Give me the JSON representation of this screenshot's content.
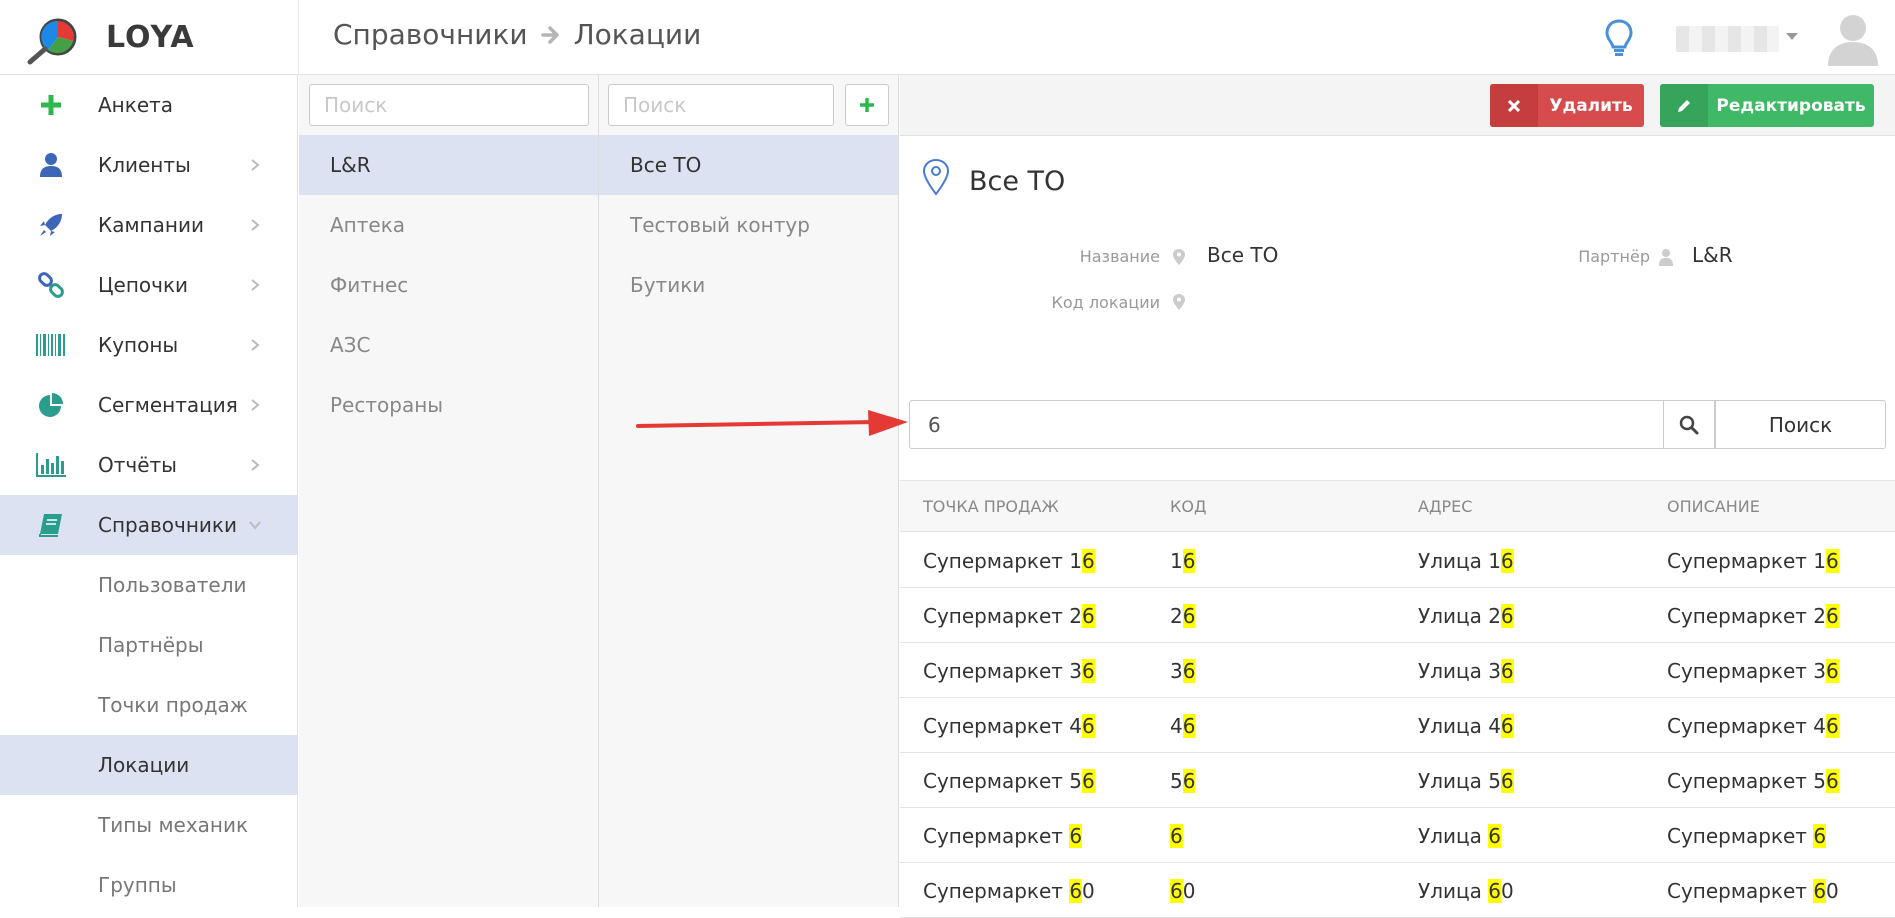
{
  "app": {
    "name": "LOYA"
  },
  "header": {
    "breadcrumb": [
      "Справочники",
      "Локации"
    ]
  },
  "colors": {
    "accent": "#dde2f3",
    "delete": "#d64b4b",
    "edit": "#3fb968",
    "highlight": "#ffff00"
  },
  "sidebar": {
    "items": [
      {
        "label": "Анкета",
        "icon": "plus-icon"
      },
      {
        "label": "Клиенты",
        "icon": "user-icon"
      },
      {
        "label": "Кампании",
        "icon": "rocket-icon"
      },
      {
        "label": "Цепочки",
        "icon": "link-icon"
      },
      {
        "label": "Купоны",
        "icon": "barcode-icon"
      },
      {
        "label": "Сегментация",
        "icon": "pie-chart-icon"
      },
      {
        "label": "Отчёты",
        "icon": "bar-chart-icon"
      },
      {
        "label": "Справочники",
        "icon": "book-icon"
      }
    ],
    "sub_items": [
      {
        "label": "Пользователи"
      },
      {
        "label": "Партнёры"
      },
      {
        "label": "Точки продаж"
      },
      {
        "label": "Локации"
      },
      {
        "label": "Типы механик"
      },
      {
        "label": "Группы"
      }
    ]
  },
  "partners": {
    "search_placeholder": "Поиск",
    "items": [
      "L&R",
      "Аптека",
      "Фитнес",
      "АЗС",
      "Рестораны"
    ]
  },
  "locations": {
    "search_placeholder": "Поиск",
    "items": [
      "Все ТО",
      "Тестовый контур",
      "Бутики"
    ]
  },
  "toolbar": {
    "delete_label": "Удалить",
    "edit_label": "Редактировать"
  },
  "detail": {
    "title": "Все ТО",
    "name_label": "Название",
    "name_value": "Все ТО",
    "partner_label": "Партнёр",
    "partner_value": "L&R",
    "code_label": "Код локации",
    "code_value": ""
  },
  "search": {
    "value": "6",
    "button_label": "Поиск"
  },
  "table": {
    "headers": [
      "Точка продаж",
      "Код",
      "Адрес",
      "Описание"
    ],
    "rows": [
      [
        "Супермаркет 16",
        "16",
        "Улица 16",
        "Супермаркет 16"
      ],
      [
        "Супермаркет 26",
        "26",
        "Улица 26",
        "Супермаркет 26"
      ],
      [
        "Супермаркет 36",
        "36",
        "Улица 36",
        "Супермаркет 36"
      ],
      [
        "Супермаркет 46",
        "46",
        "Улица 46",
        "Супермаркет 46"
      ],
      [
        "Супермаркет 56",
        "56",
        "Улица 56",
        "Супермаркет 56"
      ],
      [
        "Супермаркет 6",
        "6",
        "Улица 6",
        "Супермаркет 6"
      ],
      [
        "Супермаркет 60",
        "60",
        "Улица 60",
        "Супермаркет 60"
      ]
    ]
  }
}
